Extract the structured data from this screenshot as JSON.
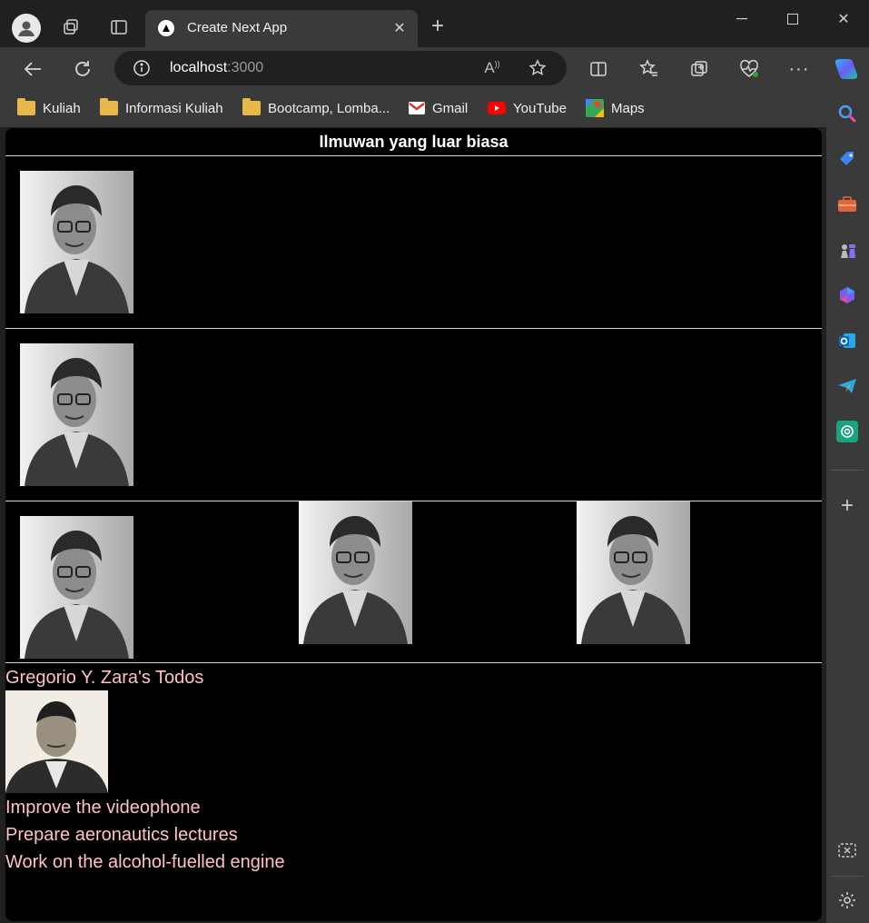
{
  "browser": {
    "tab_title": "Create Next App",
    "address": {
      "host": "localhost",
      "port": ":3000"
    },
    "bookmarks": [
      {
        "label": "Kuliah",
        "icon": "folder-icon"
      },
      {
        "label": "Informasi Kuliah",
        "icon": "folder-icon"
      },
      {
        "label": "Bootcamp, Lomba...",
        "icon": "folder-icon"
      },
      {
        "label": "Gmail",
        "icon": "gmail-icon"
      },
      {
        "label": "YouTube",
        "icon": "youtube-icon"
      },
      {
        "label": "Maps",
        "icon": "maps-icon"
      }
    ]
  },
  "page": {
    "heading": "Ilmuwan yang luar biasa",
    "todos_title": "Gregorio Y. Zara's Todos",
    "todos": [
      "Improve the videophone",
      "Prepare aeronautics lectures",
      "Work on the alcohol-fuelled engine"
    ]
  },
  "colors": {
    "page_bg": "#000000",
    "todo_text": "#ffc0cb",
    "chrome_bg": "#3a3a3a"
  }
}
